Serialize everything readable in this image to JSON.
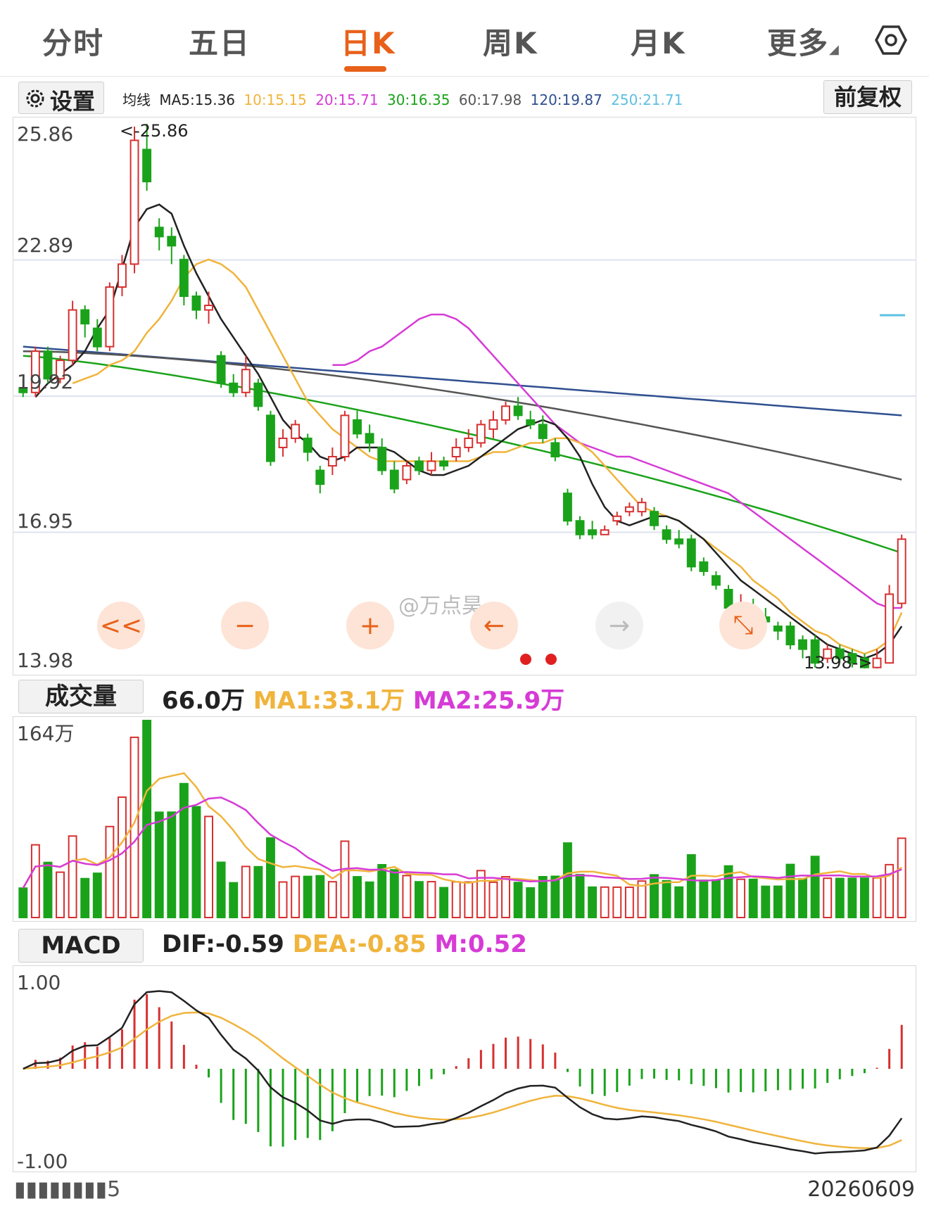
{
  "tabs": [
    {
      "label": "分时",
      "active": false
    },
    {
      "label": "五日",
      "active": false
    },
    {
      "label": "日K",
      "active": true
    },
    {
      "label": "周K",
      "active": false
    },
    {
      "label": "月K",
      "active": false
    },
    {
      "label": "更多",
      "active": false
    }
  ],
  "settings": {
    "icon": "gear-icon",
    "label": "设置",
    "fq_button": "前复权"
  },
  "ma_legend": {
    "prefix": "均线",
    "items": [
      {
        "text": "MA5:15.36",
        "color": "#222222"
      },
      {
        "text": "10:15.15",
        "color": "#f0b43c"
      },
      {
        "text": "20:15.71",
        "color": "#d63bd6"
      },
      {
        "text": "30:16.35",
        "color": "#1aa31a"
      },
      {
        "text": "60:17.98",
        "color": "#555555"
      },
      {
        "text": "120:19.87",
        "color": "#2f4f8f"
      },
      {
        "text": "250:21.71",
        "color": "#5cc0e0"
      }
    ]
  },
  "price_axis": [
    "25.86",
    "22.89",
    "19.92",
    "16.95",
    "13.98"
  ],
  "price_annotations": {
    "high": "<-25.86",
    "low": "13.98->"
  },
  "controls": [
    "<<",
    "−",
    "+",
    "←",
    "→",
    "⤡"
  ],
  "watermark": "@万点昊",
  "volume": {
    "label": "成交量",
    "value": "66.0万",
    "ma1": "MA1:33.1万",
    "ma2": "MA2:25.9万",
    "axis_top": "164万"
  },
  "macd": {
    "label": "MACD",
    "dif": "DIF:-0.59",
    "dea": "DEA:-0.85",
    "m": "M:0.52",
    "axis_top": "1.00",
    "axis_bottom": "-1.00"
  },
  "bottom": {
    "date_right": "20260609",
    "date_left": "▮▮▮▮▮▮▮▮5"
  },
  "colors": {
    "up": "#d63030",
    "down": "#1aa31a",
    "accent": "#e8611a"
  },
  "chart_data": {
    "type": "candlestick",
    "ylim": [
      13.98,
      25.86
    ],
    "candles": [
      [
        20.1,
        20.0,
        20.3,
        19.9
      ],
      [
        20.0,
        20.9,
        21.0,
        19.9
      ],
      [
        20.9,
        20.3,
        21.0,
        20.2
      ],
      [
        20.3,
        20.7,
        20.8,
        20.2
      ],
      [
        20.7,
        21.8,
        22.0,
        20.6
      ],
      [
        21.8,
        21.5,
        21.9,
        21.2
      ],
      [
        21.4,
        21.0,
        21.6,
        20.9
      ],
      [
        21.0,
        22.3,
        22.4,
        20.9
      ],
      [
        22.3,
        22.8,
        23.0,
        22.1
      ],
      [
        22.8,
        25.5,
        25.8,
        22.6
      ],
      [
        25.3,
        24.6,
        25.86,
        24.4
      ],
      [
        23.6,
        23.4,
        23.8,
        23.1
      ],
      [
        23.4,
        23.2,
        23.6,
        22.8
      ],
      [
        22.9,
        22.1,
        23.0,
        21.9
      ],
      [
        22.1,
        21.8,
        22.2,
        21.6
      ],
      [
        21.8,
        21.9,
        22.2,
        21.5
      ],
      [
        20.8,
        20.2,
        20.9,
        20.1
      ],
      [
        20.2,
        20.0,
        20.4,
        19.9
      ],
      [
        20.0,
        20.5,
        20.8,
        19.9
      ],
      [
        20.2,
        19.7,
        20.3,
        19.6
      ],
      [
        19.5,
        18.5,
        19.6,
        18.4
      ],
      [
        18.8,
        19.0,
        19.2,
        18.6
      ],
      [
        19.0,
        19.3,
        19.4,
        18.9
      ],
      [
        19.0,
        18.7,
        19.1,
        18.5
      ],
      [
        18.3,
        18.0,
        18.4,
        17.8
      ],
      [
        18.4,
        18.6,
        18.8,
        18.2
      ],
      [
        18.6,
        19.5,
        19.6,
        18.5
      ],
      [
        19.4,
        19.1,
        19.6,
        19.0
      ],
      [
        19.1,
        18.9,
        19.3,
        18.7
      ],
      [
        18.8,
        18.3,
        19.0,
        18.2
      ],
      [
        18.3,
        17.9,
        18.5,
        17.8
      ],
      [
        18.1,
        18.4,
        18.5,
        18.0
      ],
      [
        18.5,
        18.3,
        18.6,
        18.2
      ],
      [
        18.3,
        18.5,
        18.7,
        18.2
      ],
      [
        18.5,
        18.4,
        18.6,
        18.3
      ],
      [
        18.6,
        18.8,
        19.0,
        18.5
      ],
      [
        18.8,
        19.0,
        19.2,
        18.7
      ],
      [
        18.9,
        19.3,
        19.4,
        18.8
      ],
      [
        19.2,
        19.4,
        19.6,
        19.0
      ],
      [
        19.4,
        19.7,
        19.8,
        19.3
      ],
      [
        19.7,
        19.5,
        19.9,
        19.4
      ],
      [
        19.4,
        19.3,
        19.6,
        19.2
      ],
      [
        19.3,
        19.0,
        19.5,
        18.9
      ],
      [
        18.9,
        18.6,
        19.0,
        18.5
      ],
      [
        17.8,
        17.2,
        17.9,
        17.1
      ],
      [
        17.2,
        16.9,
        17.3,
        16.8
      ],
      [
        17.0,
        16.9,
        17.2,
        16.8
      ],
      [
        16.9,
        17.0,
        17.1,
        16.9
      ],
      [
        17.2,
        17.3,
        17.4,
        17.1
      ],
      [
        17.4,
        17.5,
        17.6,
        17.3
      ],
      [
        17.4,
        17.6,
        17.7,
        17.3
      ],
      [
        17.4,
        17.1,
        17.5,
        17.0
      ],
      [
        17.0,
        16.8,
        17.1,
        16.7
      ],
      [
        16.8,
        16.7,
        17.0,
        16.6
      ],
      [
        16.8,
        16.2,
        16.9,
        16.1
      ],
      [
        16.3,
        16.1,
        16.4,
        16.0
      ],
      [
        16.0,
        15.8,
        16.1,
        15.7
      ],
      [
        15.7,
        15.3,
        15.8,
        15.2
      ],
      [
        15.2,
        15.4,
        15.6,
        15.1
      ],
      [
        15.3,
        15.1,
        15.5,
        15.0
      ],
      [
        15.1,
        15.0,
        15.3,
        14.8
      ],
      [
        14.9,
        14.8,
        15.0,
        14.6
      ],
      [
        14.9,
        14.5,
        15.0,
        14.4
      ],
      [
        14.6,
        14.4,
        14.7,
        14.2
      ],
      [
        14.6,
        14.1,
        14.7,
        14.0
      ],
      [
        14.2,
        14.4,
        14.5,
        14.1
      ],
      [
        14.4,
        14.2,
        14.5,
        14.1
      ],
      [
        14.3,
        14.1,
        14.4,
        14.0
      ],
      [
        14.2,
        14.0,
        14.3,
        13.98
      ],
      [
        14.0,
        14.2,
        14.4,
        13.98
      ],
      [
        14.1,
        15.6,
        15.8,
        14.1
      ],
      [
        15.4,
        16.8,
        16.9,
        15.3
      ]
    ],
    "ma5": [
      19.9,
      20.2,
      20.4,
      20.6,
      20.9,
      21.4,
      21.8,
      22.7,
      23.6,
      24.0,
      24.1,
      23.9,
      23.2,
      22.6,
      22.1,
      21.6,
      21.2,
      20.8,
      20.4,
      19.9,
      19.4,
      19.1,
      18.9,
      18.6,
      18.5,
      18.6,
      18.8,
      18.8,
      18.8,
      18.7,
      18.5,
      18.3,
      18.2,
      18.2,
      18.3,
      18.4,
      18.6,
      18.8,
      19.0,
      19.2,
      19.3,
      19.4,
      19.3,
      19.0,
      18.6,
      18.0,
      17.5,
      17.2,
      17.1,
      17.2,
      17.3,
      17.3,
      17.2,
      17.0,
      16.8,
      16.5,
      16.2,
      15.9,
      15.7,
      15.5,
      15.3,
      15.1,
      14.9,
      14.7,
      14.5,
      14.4,
      14.3,
      14.2,
      14.3,
      14.5,
      14.9
    ],
    "ma10": [
      20.2,
      20.3,
      20.4,
      20.6,
      20.7,
      20.9,
      21.3,
      21.6,
      22.0,
      22.5,
      22.8,
      22.9,
      22.8,
      22.6,
      22.3,
      21.8,
      21.3,
      20.8,
      20.3,
      19.8,
      19.5,
      19.2,
      19.0,
      18.8,
      18.6,
      18.5,
      18.5,
      18.5,
      18.5,
      18.5,
      18.5,
      18.5,
      18.5,
      18.6,
      18.7,
      18.7,
      18.8,
      18.9,
      18.9,
      19.0,
      19.0,
      18.9,
      18.7,
      18.4,
      18.1,
      17.8,
      17.5,
      17.4,
      17.3,
      17.2,
      17.0,
      16.8,
      16.6,
      16.4,
      16.2,
      15.9,
      15.7,
      15.5,
      15.2,
      15.0,
      14.8,
      14.7,
      14.5,
      14.4,
      14.3,
      14.4,
      14.6,
      15.2
    ],
    "ma20": [
      20.6,
      20.6,
      20.7,
      20.9,
      21.0,
      21.2,
      21.4,
      21.6,
      21.7,
      21.7,
      21.6,
      21.4,
      21.1,
      20.8,
      20.5,
      20.2,
      19.9,
      19.6,
      19.3,
      19.1,
      18.9,
      18.8,
      18.7,
      18.6,
      18.6,
      18.5,
      18.4,
      18.3,
      18.2,
      18.1,
      18.0,
      17.9,
      17.8,
      17.6,
      17.4,
      17.2,
      17.0,
      16.8,
      16.6,
      16.4,
      16.2,
      16.0,
      15.8,
      15.6,
      15.4,
      15.3,
      15.3
    ]
  }
}
